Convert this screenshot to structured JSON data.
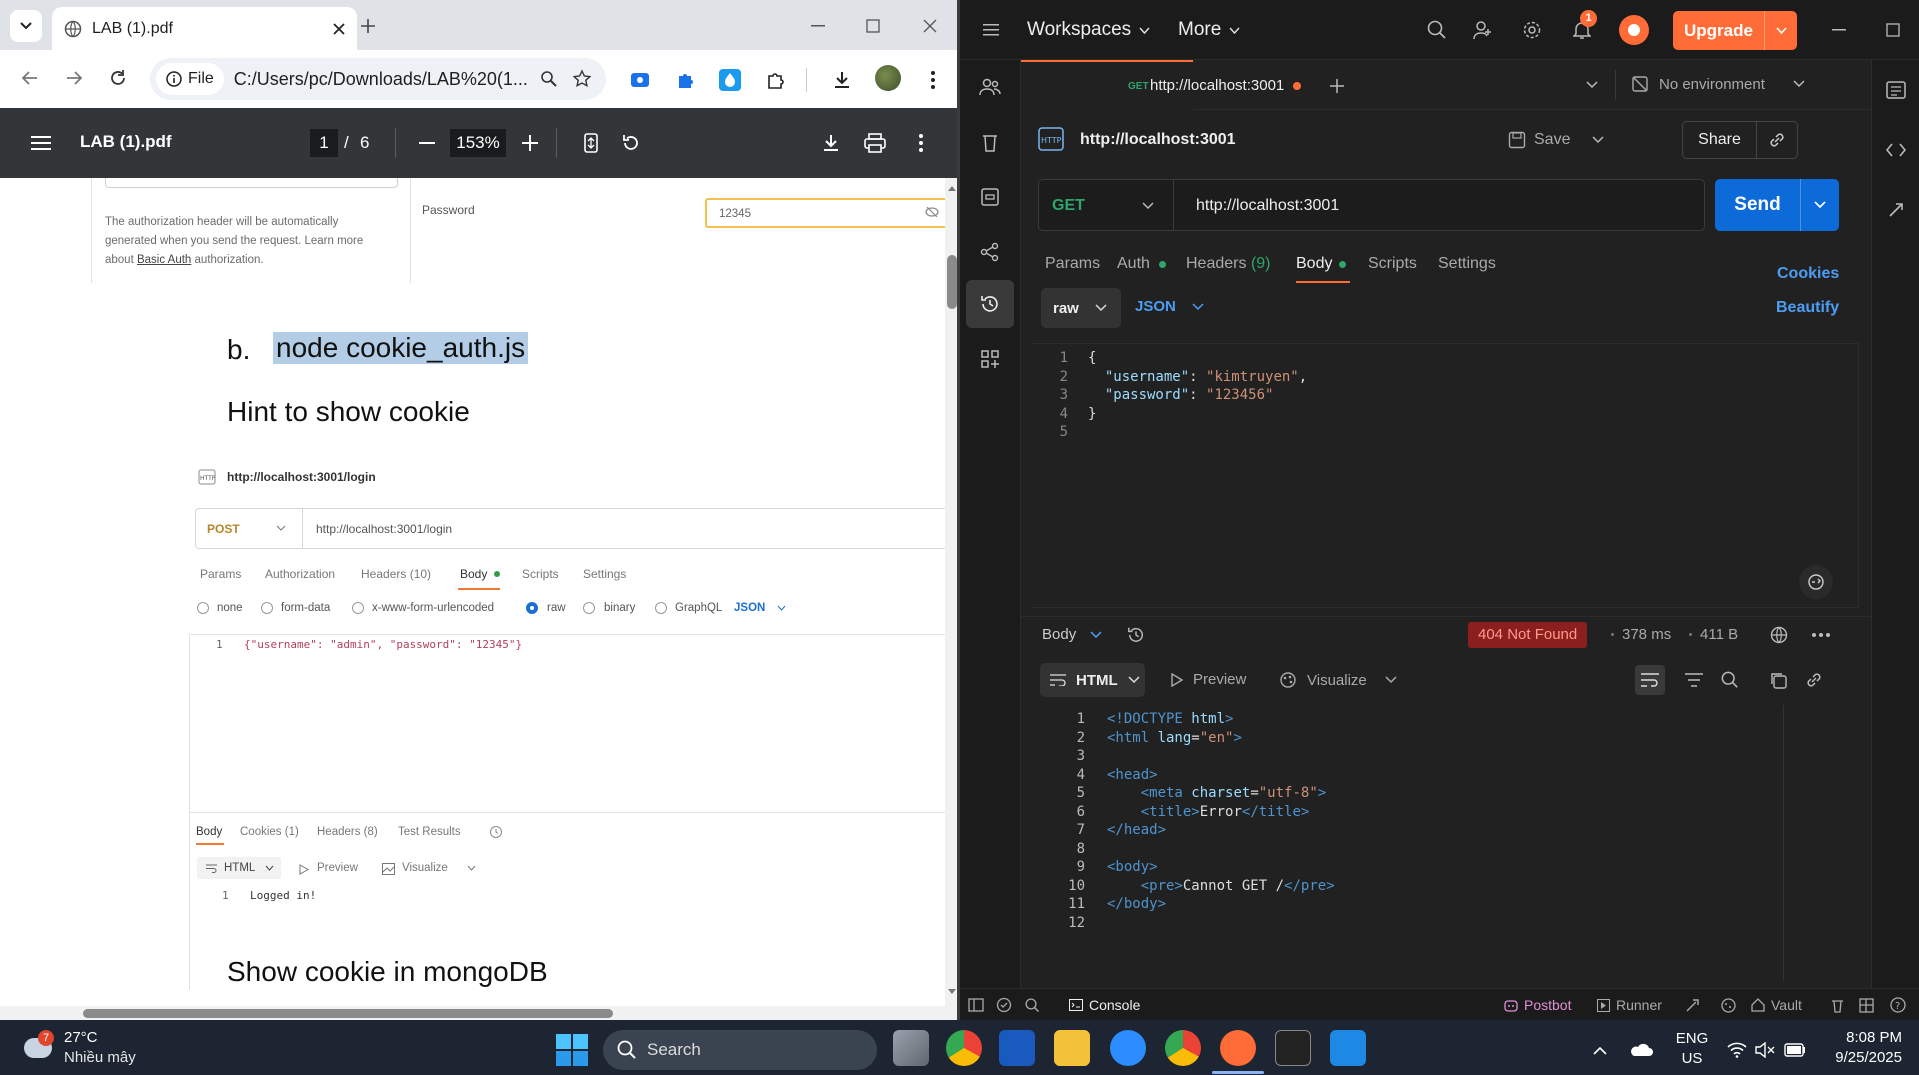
{
  "chrome": {
    "tab_title": "LAB (1).pdf",
    "file_chip": "File",
    "url": "C:/Users/pc/Downloads/LAB%20(1..."
  },
  "pdf": {
    "title": "LAB (1).pdf",
    "page_current": "1",
    "page_sep": "/",
    "page_total": "6",
    "zoom": "153%",
    "auth_note_1": "The authorization header will be automatically",
    "auth_note_2": "generated when you send the request. Learn more",
    "auth_note_3_pre": "about ",
    "auth_note_3_link": "Basic Auth",
    "auth_note_3_post": " authorization.",
    "password_label": "Password",
    "password_value": "12345",
    "item_letter": "b.",
    "item_cmd": "node cookie_auth.js",
    "hint_heading": "Hint to show cookie",
    "shot": {
      "title": "http://localhost:3001/login",
      "method": "POST",
      "url": "http://localhost:3001/login",
      "tabs": [
        "Params",
        "Authorization",
        "Headers (10)",
        "Body",
        "Scripts",
        "Settings"
      ],
      "radios": [
        "none",
        "form-data",
        "x-www-form-urlencoded",
        "raw",
        "binary",
        "GraphQL"
      ],
      "json_label": "JSON",
      "line_no": "1",
      "body_text": "{\"username\": \"admin\", \"password\": \"12345\"}",
      "resp_tabs": [
        "Body",
        "Cookies (1)",
        "Headers (8)",
        "Test Results"
      ],
      "resp_format": "HTML",
      "resp_preview": "Preview",
      "resp_visualize": "Visualize",
      "resp_line_no": "1",
      "resp_text": "Logged in!"
    },
    "mongo_heading": "Show cookie in mongoDB"
  },
  "postman": {
    "workspaces": "Workspaces",
    "more": "More",
    "notif_count": "1",
    "upgrade": "Upgrade",
    "tab_method": "GET",
    "tab_url": "http://localhost:3001",
    "no_env": "No environment",
    "req_title": "http://localhost:3001",
    "save": "Save",
    "share": "Share",
    "method": "GET",
    "url": "http://localhost:3001",
    "send": "Send",
    "req_tabs": {
      "params": "Params",
      "auth": "Auth",
      "headers": "Headers",
      "headers_count": "(9)",
      "body": "Body",
      "scripts": "Scripts",
      "settings": "Settings"
    },
    "cookies": "Cookies",
    "beautify": "Beautify",
    "body_type": "raw",
    "body_format": "JSON",
    "req_body": [
      {
        "n": "1",
        "t": "{"
      },
      {
        "n": "2",
        "k": "\"username\"",
        "v": "\"kimtruyen\"",
        "end": ","
      },
      {
        "n": "3",
        "k": "\"password\"",
        "v": "\"123456\"",
        "end": ""
      },
      {
        "n": "4",
        "t": "}"
      },
      {
        "n": "5",
        "t": ""
      }
    ],
    "resp_label": "Body",
    "status": "404 Not Found",
    "time": "378 ms",
    "size": "411 B",
    "resp_format": "HTML",
    "preview": "Preview",
    "visualize": "Visualize",
    "resp_lines": [
      {
        "n": "1",
        "html": "<span class='tg'>&lt;!DOCTYPE </span><span class='an'>html</span><span class='tg'>&gt;</span>"
      },
      {
        "n": "2",
        "html": "<span class='tg'>&lt;html </span><span class='an'>lang</span><span class='tx'>=</span><span class='av'>\"en\"</span><span class='tg'>&gt;</span>"
      },
      {
        "n": "3",
        "html": ""
      },
      {
        "n": "4",
        "html": "<span class='tg'>&lt;head&gt;</span>"
      },
      {
        "n": "5",
        "html": "&nbsp;&nbsp;&nbsp;&nbsp;<span class='tg'>&lt;meta </span><span class='an'>charset</span><span class='tx'>=</span><span class='av'>\"utf-8\"</span><span class='tg'>&gt;</span>"
      },
      {
        "n": "6",
        "html": "&nbsp;&nbsp;&nbsp;&nbsp;<span class='tg'>&lt;title&gt;</span><span class='tx'>Error</span><span class='tg'>&lt;/title&gt;</span>"
      },
      {
        "n": "7",
        "html": "<span class='tg'>&lt;/head&gt;</span>"
      },
      {
        "n": "8",
        "html": ""
      },
      {
        "n": "9",
        "html": "<span class='tg'>&lt;body&gt;</span>"
      },
      {
        "n": "10",
        "html": "&nbsp;&nbsp;&nbsp;&nbsp;<span class='tg'>&lt;pre&gt;</span><span class='tx'>Cannot GET /</span><span class='tg'>&lt;/pre&gt;</span>"
      },
      {
        "n": "11",
        "html": "<span class='tg'>&lt;/body&gt;</span>"
      },
      {
        "n": "12",
        "html": ""
      }
    ],
    "footer": {
      "console": "Console",
      "postbot": "Postbot",
      "runner": "Runner",
      "vault": "Vault"
    }
  },
  "taskbar": {
    "temp": "27°C",
    "weather": "Nhiều mây",
    "weather_badge": "7",
    "search": "Search",
    "lang1": "ENG",
    "lang2": "US",
    "time": "8:08 PM",
    "date": "9/25/2025"
  },
  "colors": {
    "postman_accent": "#ff6c37",
    "send_blue": "#0d6ad9",
    "status_red": "#8b1e1e",
    "pdf_highlight": "#b3cde6"
  }
}
